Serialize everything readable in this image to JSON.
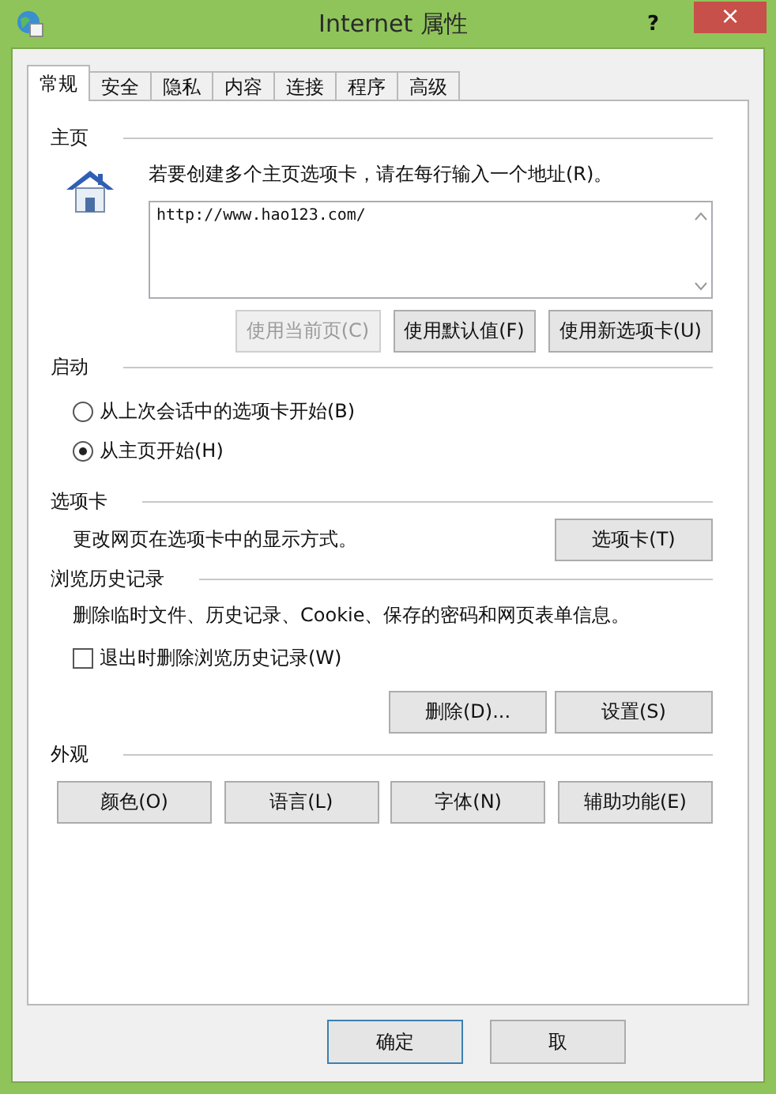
{
  "window": {
    "title": "Internet 属性",
    "help": "?",
    "close": "×"
  },
  "tabs": [
    {
      "label": "常规",
      "selected": true
    },
    {
      "label": "安全",
      "selected": false
    },
    {
      "label": "隐私",
      "selected": false
    },
    {
      "label": "内容",
      "selected": false
    },
    {
      "label": "连接",
      "selected": false
    },
    {
      "label": "程序",
      "selected": false
    },
    {
      "label": "高级",
      "selected": false
    }
  ],
  "home_page": {
    "heading": "主页",
    "instruction": "若要创建多个主页选项卡，请在每行输入一个地址(R)。",
    "address": "http://www.hao123.com/",
    "buttons": [
      {
        "label": "使用当前页(C)",
        "disabled": true
      },
      {
        "label": "使用默认值(F)",
        "disabled": false
      },
      {
        "label": "使用新选项卡(U)",
        "disabled": false
      }
    ]
  },
  "startup": {
    "heading": "启动",
    "options": [
      {
        "label": "从上次会话中的选项卡开始(B)",
        "selected": false
      },
      {
        "label": "从主页开始(H)",
        "selected": true
      }
    ]
  },
  "tabs_section": {
    "heading": "选项卡",
    "description": "更改网页在选项卡中的显示方式。",
    "button": "选项卡(T)"
  },
  "browsing_history": {
    "heading": "浏览历史记录",
    "description": "删除临时文件、历史记录、Cookie、保存的密码和网页表单信息。",
    "checkbox": {
      "label": "退出时删除浏览历史记录(W)",
      "checked": false
    },
    "buttons": [
      "删除(D)...",
      "设置(S)"
    ]
  },
  "appearance": {
    "heading": "外观",
    "buttons": [
      "颜色(O)",
      "语言(L)",
      "字体(N)",
      "辅助功能(E)"
    ]
  },
  "footer_buttons": [
    {
      "label": "确定",
      "default": true
    },
    {
      "label": "取",
      "default": false
    }
  ]
}
